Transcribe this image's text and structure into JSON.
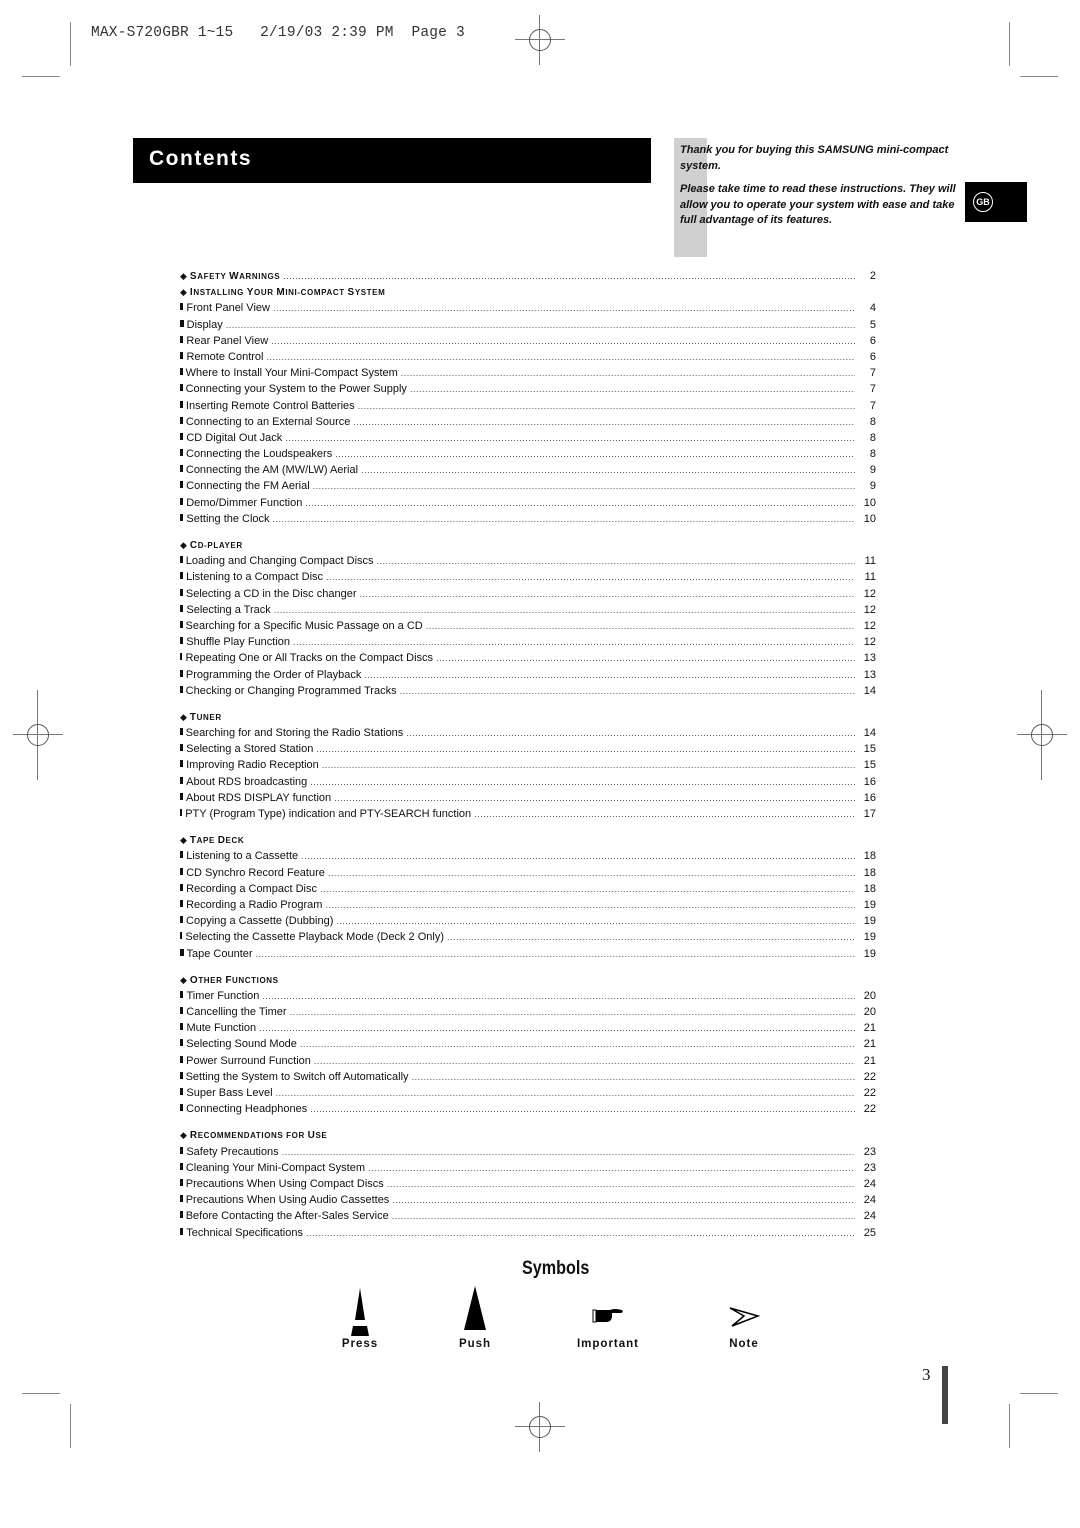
{
  "print_slug": "MAX-S720GBR 1~15   2/19/03 2:39 PM  Page 3",
  "header": {
    "title": "Contents",
    "intro_paragraphs": [
      "Thank you for buying this SAMSUNG mini-compact system.",
      "Please take time to read these instructions. They will allow you to operate your system with ease and take full advantage of its features."
    ],
    "language_badge": "GB"
  },
  "toc": {
    "sections": [
      {
        "title": "Safety Warnings",
        "page": "2",
        "items": []
      },
      {
        "title": "Installing Your Mini-Compact System",
        "page": "",
        "items": [
          {
            "label": "Front Panel View",
            "page": "4"
          },
          {
            "label": "Display",
            "page": "5"
          },
          {
            "label": "Rear Panel View",
            "page": "6"
          },
          {
            "label": "Remote Control",
            "page": "6"
          },
          {
            "label": "Where to Install Your Mini-Compact System",
            "page": "7"
          },
          {
            "label": "Connecting your System to the Power Supply",
            "page": "7"
          },
          {
            "label": "Inserting Remote Control Batteries",
            "page": "7"
          },
          {
            "label": "Connecting to an External Source",
            "page": "8"
          },
          {
            "label": "CD Digital Out Jack",
            "page": "8"
          },
          {
            "label": "Connecting the Loudspeakers",
            "page": "8"
          },
          {
            "label": "Connecting the AM (MW/LW) Aerial",
            "page": "9"
          },
          {
            "label": "Connecting the FM Aerial",
            "page": "9"
          },
          {
            "label": "Demo/Dimmer Function",
            "page": "10"
          },
          {
            "label": "Setting the Clock",
            "page": "10"
          }
        ]
      },
      {
        "title": "CD-Player",
        "page": "",
        "items": [
          {
            "label": "Loading and Changing Compact Discs",
            "page": "11"
          },
          {
            "label": "Listening to a Compact Disc",
            "page": "11"
          },
          {
            "label": "Selecting a CD in the Disc changer",
            "page": "12"
          },
          {
            "label": "Selecting a Track",
            "page": "12"
          },
          {
            "label": "Searching for a Specific Music Passage on a CD",
            "page": "12"
          },
          {
            "label": "Shuffle Play Function",
            "page": "12"
          },
          {
            "label": "Repeating One or All Tracks on the Compact Discs",
            "page": "13"
          },
          {
            "label": "Programming the Order of Playback",
            "page": "13"
          },
          {
            "label": "Checking or Changing Programmed Tracks",
            "page": "14"
          }
        ]
      },
      {
        "title": "Tuner",
        "page": "",
        "items": [
          {
            "label": "Searching for and Storing the Radio Stations",
            "page": "14"
          },
          {
            "label": "Selecting a Stored Station",
            "page": "15"
          },
          {
            "label": "Improving Radio Reception",
            "page": "15"
          },
          {
            "label": "About RDS broadcasting",
            "page": "16"
          },
          {
            "label": "About RDS DISPLAY function",
            "page": "16"
          },
          {
            "label": "PTY (Program Type) indication and PTY-SEARCH function",
            "page": "17"
          }
        ]
      },
      {
        "title": "Tape Deck",
        "page": "",
        "items": [
          {
            "label": "Listening to a Cassette",
            "page": "18"
          },
          {
            "label": "CD Synchro Record Feature",
            "page": "18"
          },
          {
            "label": "Recording a Compact Disc",
            "page": "18"
          },
          {
            "label": "Recording a Radio Program",
            "page": "19"
          },
          {
            "label": "Copying a Cassette (Dubbing)",
            "page": "19"
          },
          {
            "label": "Selecting the Cassette Playback Mode (Deck 2 Only)",
            "page": "19"
          },
          {
            "label": "Tape Counter",
            "page": "19"
          }
        ]
      },
      {
        "title": "Other Functions",
        "page": "",
        "items": [
          {
            "label": "Timer Function",
            "page": "20"
          },
          {
            "label": "Cancelling the Timer",
            "page": "20"
          },
          {
            "label": "Mute Function",
            "page": "21"
          },
          {
            "label": "Selecting Sound  Mode",
            "page": "21"
          },
          {
            "label": "Power Surround Function",
            "page": "21"
          },
          {
            "label": "Setting the System to Switch off Automatically",
            "page": "22"
          },
          {
            "label": "Super Bass Level",
            "page": "22"
          },
          {
            "label": "Connecting Headphones",
            "page": "22"
          }
        ]
      },
      {
        "title": "Recommendations for Use",
        "page": "",
        "items": [
          {
            "label": "Safety Precautions",
            "page": "23"
          },
          {
            "label": "Cleaning Your Mini-Compact System",
            "page": "23"
          },
          {
            "label": "Precautions When Using Compact Discs",
            "page": "24"
          },
          {
            "label": "Precautions When Using Audio Cassettes",
            "page": "24"
          },
          {
            "label": "Before Contacting the After-Sales Service",
            "page": "24"
          },
          {
            "label": "Technical Specifications",
            "page": "25"
          }
        ]
      }
    ]
  },
  "symbols": {
    "title": "Symbols",
    "items": [
      {
        "icon": "press-icon",
        "label": "Press"
      },
      {
        "icon": "push-icon",
        "label": "Push"
      },
      {
        "icon": "pointing-hand-icon",
        "label": "Important"
      },
      {
        "icon": "note-arrow-icon",
        "label": "Note"
      }
    ]
  },
  "page_number": "3"
}
